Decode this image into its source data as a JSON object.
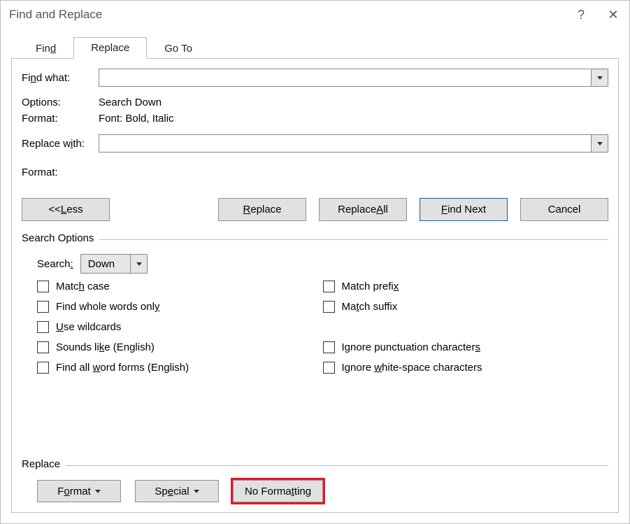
{
  "title": "Find and Replace",
  "titlebar": {
    "help": "?",
    "close": "✕"
  },
  "tabs": {
    "find_pre": "Fin",
    "find_u": "d",
    "replace": "Replace",
    "goto": "Go To"
  },
  "find": {
    "label": "Find what:",
    "value": "",
    "options_label": "Options:",
    "options_value": "Search Down",
    "format_label": "Format:",
    "format_value": "Font: Bold, Italic"
  },
  "replace": {
    "label": "Replace with:",
    "value": "",
    "format_label": "Format:"
  },
  "buttons": {
    "less_pre": "<< ",
    "less_u": "L",
    "less_post": "ess",
    "replace_u": "R",
    "replace_post": "eplace",
    "replaceall_pre": "Replace ",
    "replaceall_u": "A",
    "replaceall_post": "ll",
    "findnext_u": "F",
    "findnext_post": "ind Next",
    "cancel": "Cancel"
  },
  "searchOptions": {
    "title": "Search Options",
    "search_label": "Search:",
    "search_value": "Down",
    "left": [
      {
        "pre": "Matc",
        "u": "h",
        "post": " case"
      },
      {
        "pre": "Find whole words onl",
        "u": "y",
        "post": ""
      },
      {
        "pre": "",
        "u": "U",
        "post": "se wildcards"
      },
      {
        "pre": "Sounds li",
        "u": "k",
        "post": "e (English)"
      },
      {
        "pre": "Find all ",
        "u": "w",
        "post": "ord forms (English)"
      }
    ],
    "right": [
      {
        "pre": "Match prefi",
        "u": "x",
        "post": ""
      },
      {
        "pre": "Ma",
        "u": "t",
        "post": "ch suffix"
      },
      {
        "pre": "",
        "u": "",
        "post": ""
      },
      {
        "pre": "Ignore punctuation character",
        "u": "s",
        "post": ""
      },
      {
        "pre": "Ignore ",
        "u": "w",
        "post": "hite-space characters"
      }
    ]
  },
  "replaceSection": {
    "title": "Replace",
    "format_pre": "F",
    "format_u": "o",
    "format_post": "rmat",
    "special_pre": "Sp",
    "special_u": "e",
    "special_post": "cial",
    "nofmt_pre": "No Forma",
    "nofmt_u": "t",
    "nofmt_post": "ting"
  }
}
